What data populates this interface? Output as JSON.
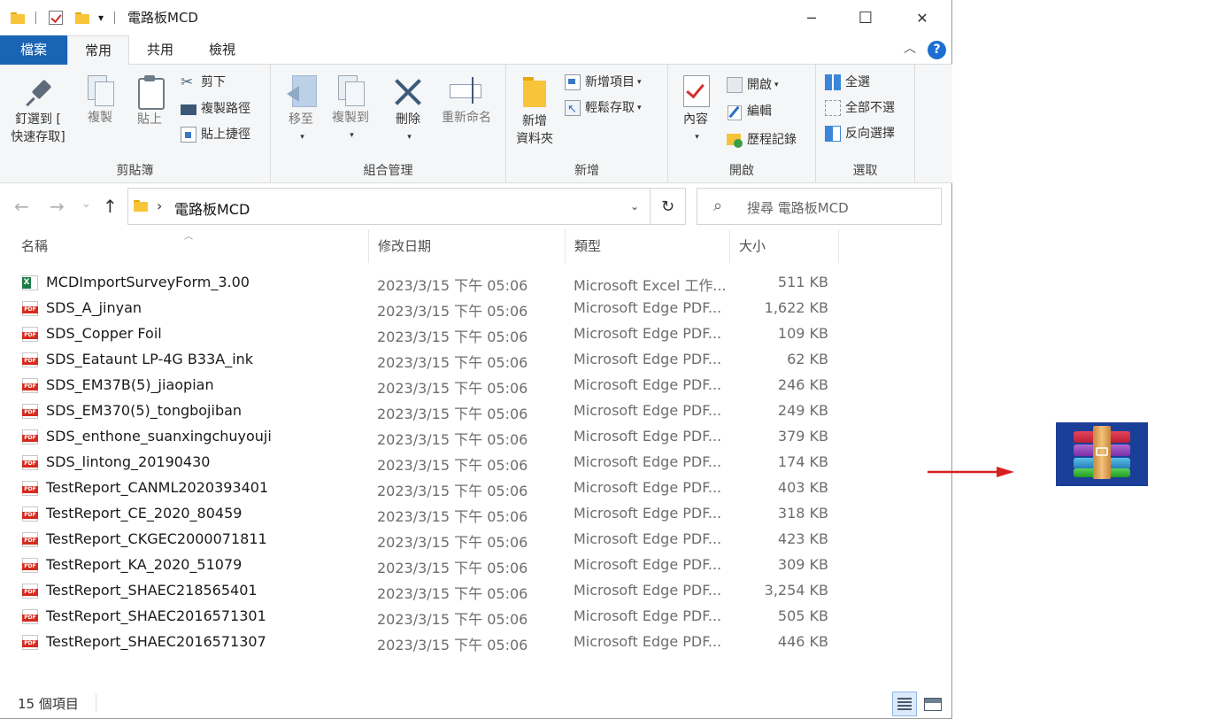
{
  "titlebar": {
    "title": "電路板MCD",
    "quick_access_dropdown": "▾",
    "minimize": "─",
    "maximize": "☐",
    "close": "✕"
  },
  "tabs": [
    {
      "label": "檔案"
    },
    {
      "label": "常用"
    },
    {
      "label": "共用"
    },
    {
      "label": "檢視"
    }
  ],
  "ribbon": {
    "clipboard": {
      "label": "剪貼簿",
      "pin_line1": "釘選到 [",
      "pin_line2": "快速存取]",
      "copy": "複製",
      "paste": "貼上",
      "cut": "剪下",
      "copy_path": "複製路徑",
      "paste_shortcut": "貼上捷徑"
    },
    "organize": {
      "label": "組合管理",
      "move_to": "移至",
      "copy_to": "複製到",
      "delete": "刪除",
      "rename": "重新命名"
    },
    "new": {
      "label": "新增",
      "new_folder_line1": "新增",
      "new_folder_line2": "資料夾",
      "new_item": "新增項目",
      "easy_access": "輕鬆存取"
    },
    "open": {
      "label": "開啟",
      "properties": "內容",
      "open": "開啟",
      "edit": "編輯",
      "history": "歷程記錄"
    },
    "select": {
      "label": "選取",
      "select_all": "全選",
      "select_none": "全部不選",
      "invert": "反向選擇"
    }
  },
  "address": {
    "separator": "›",
    "path": "電路板MCD",
    "refresh": "↻",
    "search_placeholder": "搜尋 電路板MCD",
    "back": "←",
    "forward": "→",
    "recent": "⌄",
    "up": "↑"
  },
  "columns": {
    "name": "名稱",
    "date": "修改日期",
    "type": "類型",
    "size": "大小"
  },
  "files": [
    {
      "icon": "excel-file-icon",
      "name": "MCDImportSurveyForm_3.00",
      "date": "2023/3/15 下午 05:06",
      "type": "Microsoft Excel 工作...",
      "size": "511 KB"
    },
    {
      "icon": "pdf-file-icon",
      "name": "SDS_A_jinyan",
      "date": "2023/3/15 下午 05:06",
      "type": "Microsoft Edge PDF...",
      "size": "1,622 KB"
    },
    {
      "icon": "pdf-file-icon",
      "name": "SDS_Copper Foil",
      "date": "2023/3/15 下午 05:06",
      "type": "Microsoft Edge PDF...",
      "size": "109 KB"
    },
    {
      "icon": "pdf-file-icon",
      "name": "SDS_Eataunt LP-4G B33A_ink",
      "date": "2023/3/15 下午 05:06",
      "type": "Microsoft Edge PDF...",
      "size": "62 KB"
    },
    {
      "icon": "pdf-file-icon",
      "name": "SDS_EM37B(5)_jiaopian",
      "date": "2023/3/15 下午 05:06",
      "type": "Microsoft Edge PDF...",
      "size": "246 KB"
    },
    {
      "icon": "pdf-file-icon",
      "name": "SDS_EM370(5)_tongbojiban",
      "date": "2023/3/15 下午 05:06",
      "type": "Microsoft Edge PDF...",
      "size": "249 KB"
    },
    {
      "icon": "pdf-file-icon",
      "name": "SDS_enthone_suanxingchuyouji",
      "date": "2023/3/15 下午 05:06",
      "type": "Microsoft Edge PDF...",
      "size": "379 KB"
    },
    {
      "icon": "pdf-file-icon",
      "name": "SDS_lintong_20190430",
      "date": "2023/3/15 下午 05:06",
      "type": "Microsoft Edge PDF...",
      "size": "174 KB"
    },
    {
      "icon": "pdf-file-icon",
      "name": "TestReport_CANML2020393401",
      "date": "2023/3/15 下午 05:06",
      "type": "Microsoft Edge PDF...",
      "size": "403 KB"
    },
    {
      "icon": "pdf-file-icon",
      "name": "TestReport_CE_2020_80459",
      "date": "2023/3/15 下午 05:06",
      "type": "Microsoft Edge PDF...",
      "size": "318 KB"
    },
    {
      "icon": "pdf-file-icon",
      "name": "TestReport_CKGEC2000071811",
      "date": "2023/3/15 下午 05:06",
      "type": "Microsoft Edge PDF...",
      "size": "423 KB"
    },
    {
      "icon": "pdf-file-icon",
      "name": "TestReport_KA_2020_51079",
      "date": "2023/3/15 下午 05:06",
      "type": "Microsoft Edge PDF...",
      "size": "309 KB"
    },
    {
      "icon": "pdf-file-icon",
      "name": "TestReport_SHAEC218565401",
      "date": "2023/3/15 下午 05:06",
      "type": "Microsoft Edge PDF...",
      "size": "3,254 KB"
    },
    {
      "icon": "pdf-file-icon",
      "name": "TestReport_SHAEC2016571301",
      "date": "2023/3/15 下午 05:06",
      "type": "Microsoft Edge PDF...",
      "size": "505 KB"
    },
    {
      "icon": "pdf-file-icon",
      "name": "TestReport_SHAEC2016571307",
      "date": "2023/3/15 下午 05:06",
      "type": "Microsoft Edge PDF...",
      "size": "446 KB"
    }
  ],
  "status": {
    "item_count": "15 個項目"
  },
  "colors": {
    "file_tab": "#1a64b4",
    "arrow": "#d62020",
    "rar_background": "#1b3f98",
    "pdf_red": "#d52b1e",
    "excel_green": "#1d7a45"
  }
}
